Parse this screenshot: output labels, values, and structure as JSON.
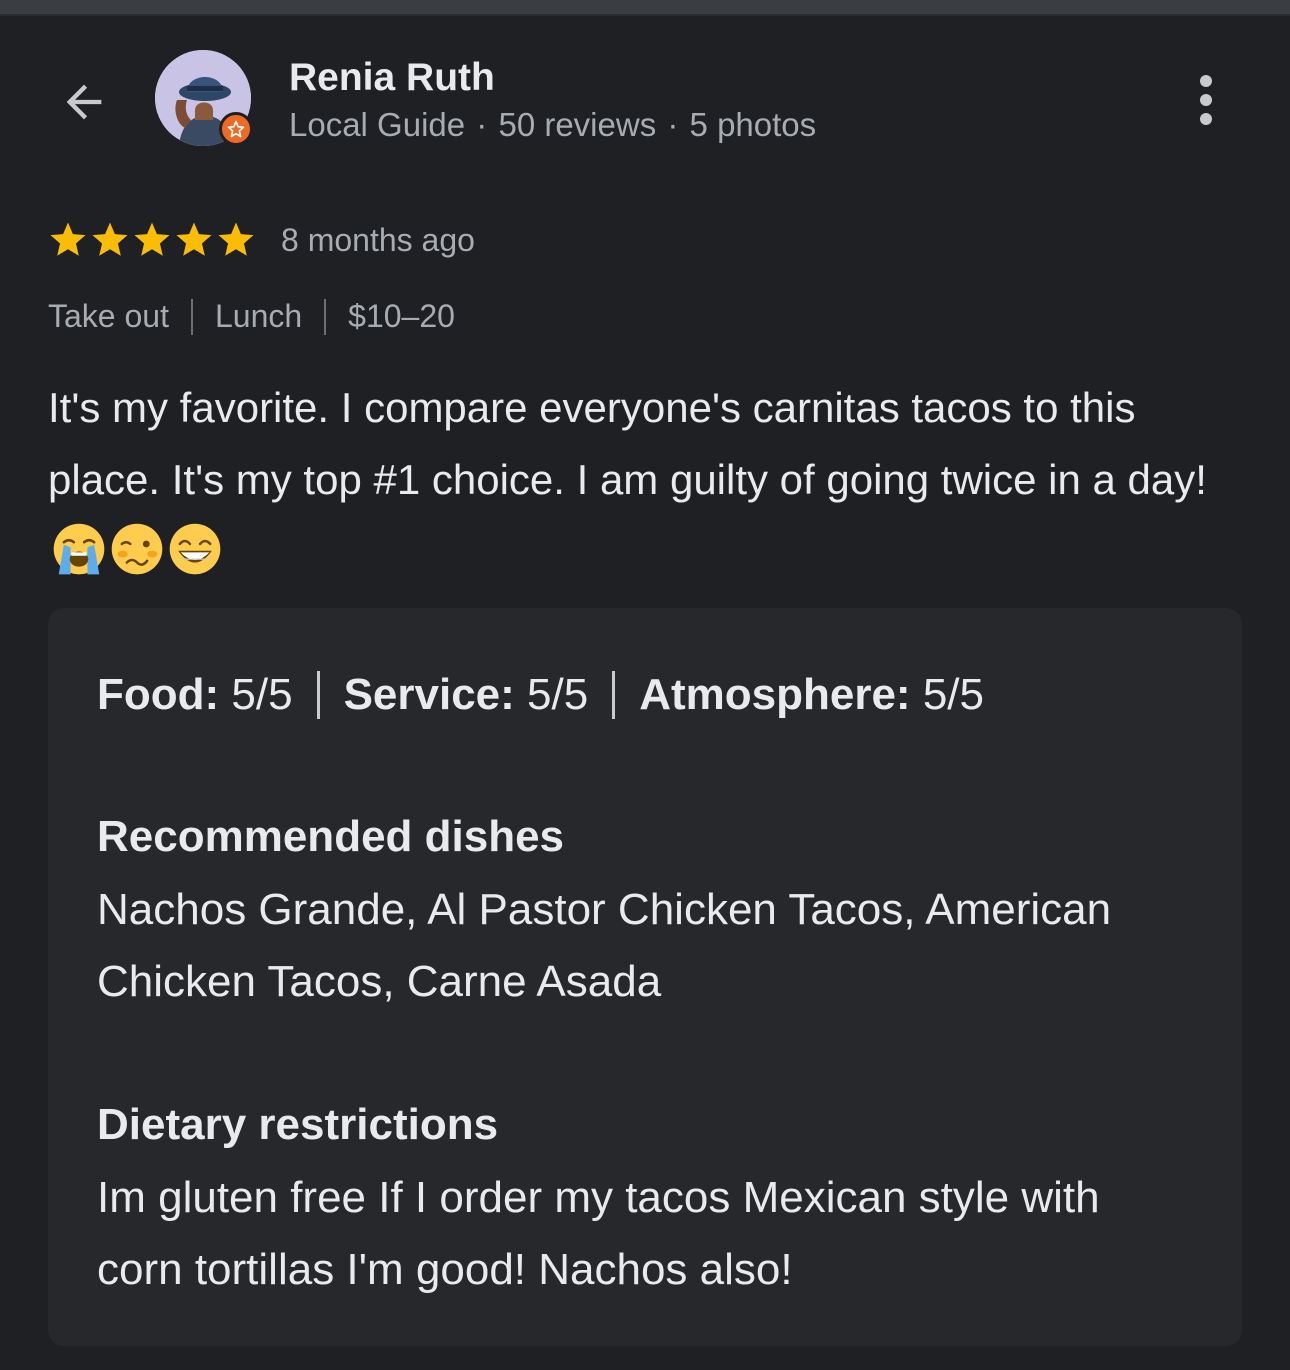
{
  "header": {
    "user_name": "Renia Ruth",
    "guide_label": "Local Guide",
    "reviews_count": "50 reviews",
    "photos_count": "5 photos",
    "separator": "·"
  },
  "review": {
    "rating": 5,
    "max_rating": 5,
    "time_ago": "8 months ago",
    "tags": [
      "Take out",
      "Lunch",
      "$10–20"
    ],
    "text": "It's my favorite. I compare everyone's carnitas tacos to this place. It's my top #1 choice. I am guilty of going twice in a day!",
    "emojis": [
      "loudly-crying-face",
      "woozy-face",
      "grinning-face"
    ]
  },
  "attributes": {
    "food_label": "Food:",
    "food_value": "5/5",
    "service_label": "Service:",
    "service_value": "5/5",
    "atmosphere_label": "Atmosphere:",
    "atmosphere_value": "5/5",
    "recommended_title": "Recommended dishes",
    "recommended_text": "Nachos Grande, Al Pastor Chicken Tacos, American Chicken Tacos, Carne Asada",
    "dietary_title": "Dietary restrictions",
    "dietary_text": "Im gluten free If I order my tacos Mexican style with corn tortillas I'm good! Nachos also!"
  },
  "colors": {
    "background": "#1f2023",
    "card": "#27282c",
    "star": "#fbbc04",
    "badge": "#f06a23",
    "secondary_text": "#a8abb1"
  }
}
